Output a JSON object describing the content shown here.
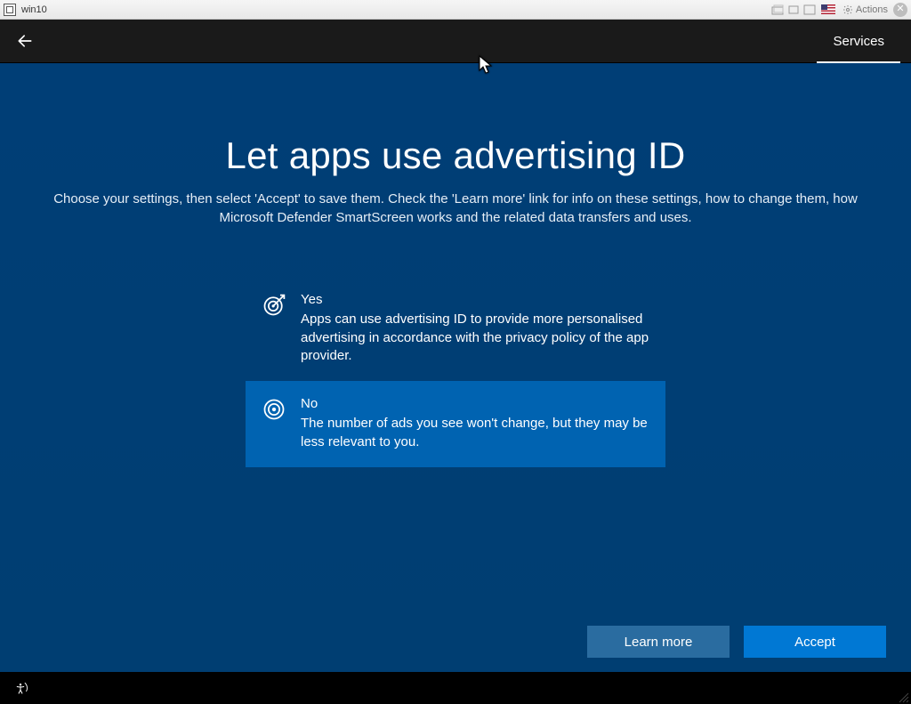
{
  "vm": {
    "title": "win10",
    "actions_label": "Actions"
  },
  "topbar": {
    "tab_services": "Services"
  },
  "page": {
    "heading": "Let apps use advertising ID",
    "subtitle": "Choose your settings, then select 'Accept' to save them. Check the 'Learn more' link for info on these settings, how to change them, how Microsoft Defender SmartScreen works and the related data transfers and uses."
  },
  "options": {
    "yes": {
      "title": "Yes",
      "desc": "Apps can use advertising ID to provide more personalised advertising in accordance with the privacy policy of the app provider."
    },
    "no": {
      "title": "No",
      "desc": "The number of ads you see won't change, but they may be less relevant to you."
    },
    "selected": "no"
  },
  "buttons": {
    "learn_more": "Learn more",
    "accept": "Accept"
  }
}
